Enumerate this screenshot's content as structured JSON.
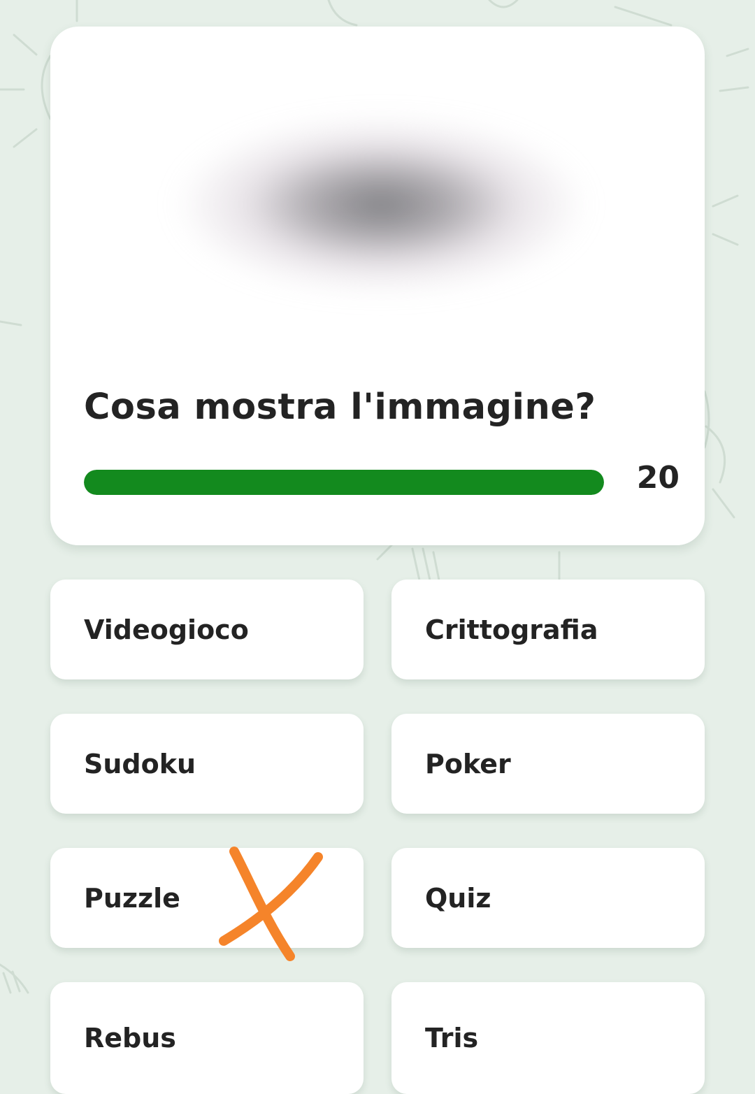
{
  "question": {
    "text": "Cosa mostra l'immagine?",
    "image": "blurred-image",
    "timer": {
      "value": "20",
      "progress_fraction": 1.0,
      "color": "#138a1e"
    }
  },
  "answers": [
    {
      "label": "Videogioco"
    },
    {
      "label": "Crittografia"
    },
    {
      "label": "Sudoku"
    },
    {
      "label": "Poker"
    },
    {
      "label": "Puzzle"
    },
    {
      "label": "Quiz"
    },
    {
      "label": "Rebus"
    },
    {
      "label": "Tris"
    }
  ],
  "annotation": {
    "icon": "cross-mark-icon",
    "color": "#f5842a",
    "on_answer": "Puzzle"
  },
  "colors": {
    "background": "#e6efe8",
    "card": "#ffffff",
    "text": "#232323"
  }
}
